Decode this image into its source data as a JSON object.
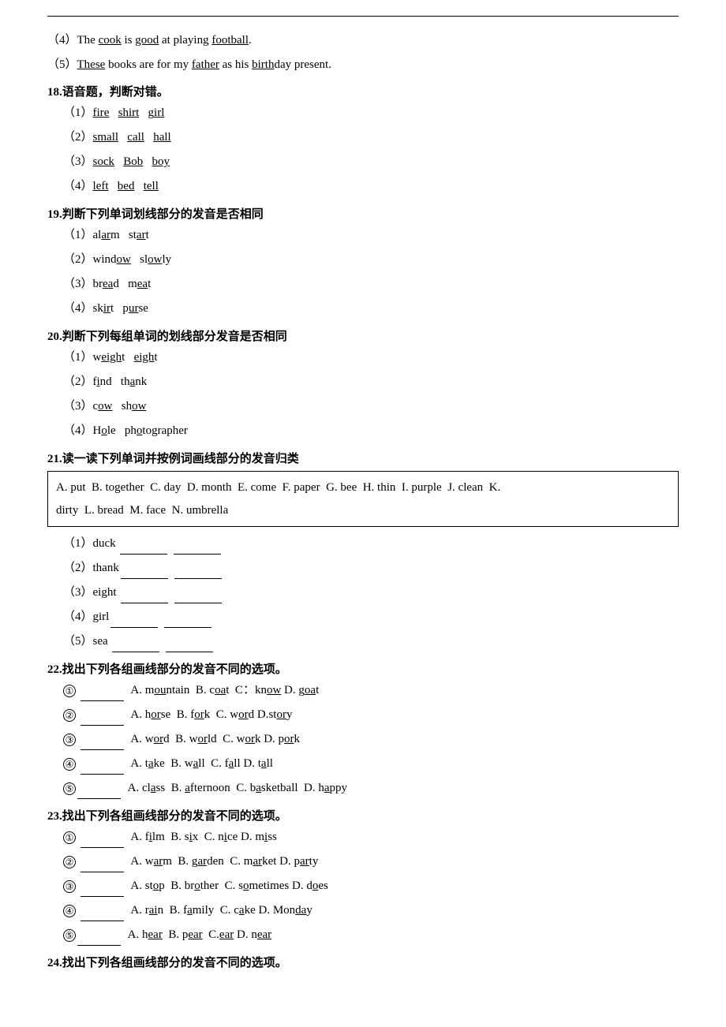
{
  "top_border": true,
  "items": [
    {
      "id": "item-4",
      "type": "line",
      "text": "（4）The cook is good at playing football.",
      "underlines": [
        "cook",
        "good",
        "football"
      ]
    },
    {
      "id": "item-5",
      "type": "line",
      "text": "（5）These books are for my father as his birthday present.",
      "underlines": [
        "These",
        "father",
        "birthday"
      ]
    }
  ],
  "q18": {
    "title": "18.语音题，判断对错。",
    "items": [
      {
        "label": "（1）",
        "words": [
          {
            "text": "fire",
            "ul": true
          },
          {
            "text": "shirt",
            "ul": true
          },
          {
            "text": "girl",
            "ul": true
          }
        ]
      },
      {
        "label": "（2）",
        "words": [
          {
            "text": "small",
            "ul": true
          },
          {
            "text": "call",
            "ul": true
          },
          {
            "text": "hall",
            "ul": true
          }
        ]
      },
      {
        "label": "（3）",
        "words": [
          {
            "text": "sock",
            "ul": true
          },
          {
            "text": "Bob",
            "ul": true
          },
          {
            "text": "boy",
            "ul": true
          }
        ]
      },
      {
        "label": "（4）",
        "words": [
          {
            "text": "left",
            "ul": true
          },
          {
            "text": "bed",
            "ul": true
          },
          {
            "text": "tell",
            "ul": true
          }
        ]
      }
    ]
  },
  "q19": {
    "title": "19.判断下列单词划线部分的发音是否相同",
    "items": [
      {
        "label": "（1）",
        "words": [
          {
            "text": "alarm",
            "ul": "arm"
          },
          {
            "text": "start",
            "ul": "ar"
          }
        ]
      },
      {
        "label": "（2）",
        "words": [
          {
            "text": "window",
            "ul": "ow"
          },
          {
            "text": "slowly",
            "ul": "ow"
          }
        ]
      },
      {
        "label": "（3）",
        "words": [
          {
            "text": "bread",
            "ul": "ea"
          },
          {
            "text": "meat",
            "ul": "ea"
          }
        ]
      },
      {
        "label": "（4）",
        "words": [
          {
            "text": "skirt",
            "ul": "ir"
          },
          {
            "text": "purse",
            "ul": "ur"
          }
        ]
      }
    ]
  },
  "q20": {
    "title": "20.判断下列每组单词的划线部分发音是否相同",
    "items": [
      {
        "label": "（1）",
        "words": [
          {
            "text": "weight",
            "ul": "eigh"
          },
          {
            "text": "eight",
            "ul": "eigh"
          }
        ]
      },
      {
        "label": "（2）",
        "words": [
          {
            "text": "find",
            "ul": "i"
          },
          {
            "text": "thank",
            "ul": "a"
          }
        ]
      },
      {
        "label": "（3）",
        "words": [
          {
            "text": "cow",
            "ul": "ow"
          },
          {
            "text": "show",
            "ul": "ow"
          }
        ]
      },
      {
        "label": "（4）",
        "words": [
          {
            "text": "Hole",
            "ul": "o"
          },
          {
            "text": "photographer",
            "ul": "o"
          }
        ]
      }
    ]
  },
  "q21": {
    "title": "21.读一读下列单词并按例词画线部分的发音归类",
    "box_text": "A. put  B. together  C. day  D. month  E. come  F. paper  G. bee  H. thin  I. purple  J. clean  K. dirty  L. bread  M. face  N. umbrella",
    "items": [
      {
        "label": "（1）duck",
        "blanks": 2
      },
      {
        "label": "（2）thank",
        "blanks": 2
      },
      {
        "label": "（3）eight",
        "blanks": 2
      },
      {
        "label": "（4）girl",
        "blanks": 2
      },
      {
        "label": "（5）sea",
        "blanks": 2
      }
    ]
  },
  "q22": {
    "title": "22.找出下列各组画线部分的发音不同的选项。",
    "items": [
      {
        "num": "①",
        "blank": true,
        "options": "A. mountain  B. coat  C：know D. goat",
        "underlines": [
          "ou",
          "oa",
          "ow",
          "oa"
        ]
      },
      {
        "num": "②",
        "blank": true,
        "options": "A. horse  B. fork  C. word  D.story",
        "underlines": [
          "or",
          "or",
          "or",
          "or"
        ]
      },
      {
        "num": "③",
        "blank": true,
        "options": "A. word  B. world  C. work D. pork",
        "underlines": [
          "or",
          "or",
          "or",
          "or"
        ]
      },
      {
        "num": "④",
        "blank": true,
        "options": "A. take  B. wall  C. fall D. tall",
        "underlines": [
          "a",
          "a",
          "a",
          "a"
        ]
      },
      {
        "num": "⑤",
        "blank": true,
        "options": "A. class  B. afternoon  C. basketball  D. happy",
        "underlines": [
          "a",
          "a",
          "a",
          "a"
        ]
      }
    ]
  },
  "q23": {
    "title": "23.找出下列各组画线部分的发音不同的选项。",
    "items": [
      {
        "num": "①",
        "blank": true,
        "options": "A. film  B. six  C. nice D. miss",
        "underlines": [
          "i",
          "i",
          "i",
          "i"
        ]
      },
      {
        "num": "②",
        "blank": true,
        "options": "A. warm  B. garden  C. market D. party",
        "underlines": [
          "ar",
          "ar",
          "ar",
          "ar"
        ]
      },
      {
        "num": "③",
        "blank": true,
        "options": "A. stop  B. brother  C. sometimes D. does",
        "underlines": [
          "o",
          "o",
          "o",
          "o"
        ]
      },
      {
        "num": "④",
        "blank": true,
        "options": "A. rain  B. family  C. cake D. Monday",
        "underlines": [
          "ai",
          "a",
          "a",
          "a"
        ]
      },
      {
        "num": "⑤",
        "blank": true,
        "options": "A. hear  B. pear  C. ear D. near",
        "underlines": [
          "ear",
          "ear",
          "ear",
          "ear"
        ]
      }
    ]
  },
  "q24": {
    "title": "24.找出下列各组画线部分的发音不同的选项。"
  }
}
